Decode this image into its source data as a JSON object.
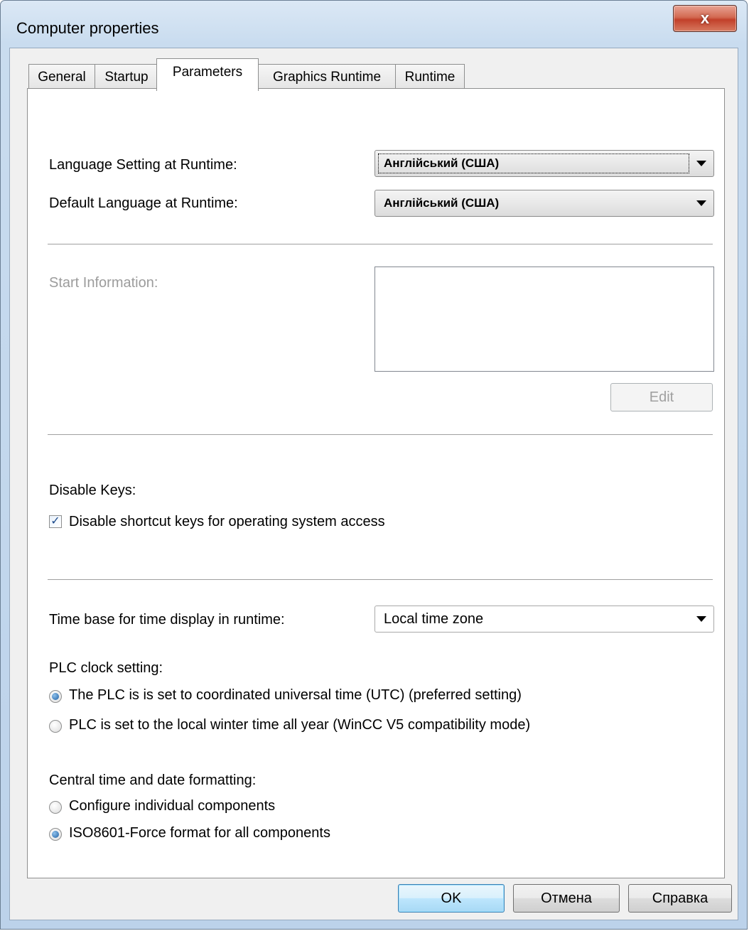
{
  "window": {
    "title": "Computer properties",
    "close_label": "x"
  },
  "tabs": [
    {
      "label": "General"
    },
    {
      "label": "Startup"
    },
    {
      "label": "Parameters"
    },
    {
      "label": "Graphics Runtime"
    },
    {
      "label": "Runtime"
    }
  ],
  "active_tab": "Parameters",
  "language": {
    "runtime_label": "Language Setting at Runtime:",
    "runtime_value": "Англійський (США)",
    "default_label": "Default Language at Runtime:",
    "default_value": "Англійський (США)"
  },
  "start_info": {
    "label": "Start Information:",
    "text": "",
    "edit_label": "Edit"
  },
  "disable_keys": {
    "label": "Disable Keys:",
    "checkbox_label": "Disable shortcut keys for operating system access",
    "checked": true
  },
  "time": {
    "base_label": "Time base for time display in runtime:",
    "base_value": "Local time zone",
    "plc_label": "PLC clock setting:",
    "plc_options": [
      {
        "label": "The PLC is is set to coordinated universal time (UTC) (preferred setting)",
        "checked": true
      },
      {
        "label": "PLC is set to the local winter time all year (WinCC V5 compatibility mode)",
        "checked": false
      }
    ],
    "format_label": "Central time and date formatting:",
    "format_options": [
      {
        "label": "Configure individual components",
        "checked": false
      },
      {
        "label": "ISO8601-Force format for all components",
        "checked": true
      }
    ]
  },
  "footer": {
    "ok_label": "OK",
    "cancel_label": "Отмена",
    "help_label": "Справка"
  }
}
